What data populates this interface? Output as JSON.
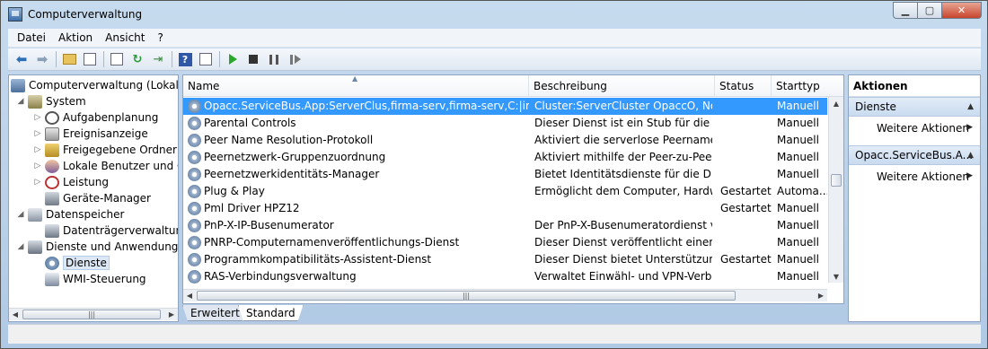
{
  "window": {
    "title": "Computerverwaltung"
  },
  "menu": [
    "Datei",
    "Aktion",
    "Ansicht",
    "?"
  ],
  "toolbar": {
    "icons": [
      "back-icon",
      "forward-icon",
      "up-folder-icon",
      "show-hide-tree-icon",
      "properties-icon",
      "refresh-icon",
      "export-icon",
      "help-icon",
      "console-view-icon",
      "start-service-icon",
      "stop-service-icon",
      "pause-service-icon",
      "restart-service-icon"
    ]
  },
  "tree": {
    "root": "Computerverwaltung (Lokal)",
    "system": "System",
    "aufgabenplanung": "Aufgabenplanung",
    "ereignisanzeige": "Ereignisanzeige",
    "freigegebene_ordner": "Freigegebene Ordner",
    "lokale_benutzer": "Lokale Benutzer und Gru",
    "leistung": "Leistung",
    "geraete_manager": "Geräte-Manager",
    "datenspeicher": "Datenspeicher",
    "datentraegerverwaltung": "Datenträgerverwaltung",
    "dienste_anwendungen": "Dienste und Anwendungen",
    "dienste": "Dienste",
    "wmi": "WMI-Steuerung"
  },
  "services": {
    "columns": {
      "name": "Name",
      "beschreibung": "Beschreibung",
      "status": "Status",
      "starttyp": "Starttyp"
    },
    "rows": [
      {
        "name": "Opacc.ServiceBus.App:ServerClus,firma-serv,firma-serv,C:|insyde",
        "desc": "Cluster:ServerCluster OpaccO, Nod...",
        "status": "",
        "start": "Manuell"
      },
      {
        "name": "Parental Controls",
        "desc": "Dieser Dienst ist ein Stub für die Wi...",
        "status": "",
        "start": "Manuell"
      },
      {
        "name": "Peer Name Resolution-Protokoll",
        "desc": "Aktiviert die serverlose Peernamens...",
        "status": "",
        "start": "Manuell"
      },
      {
        "name": "Peernetzwerk-Gruppenzuordnung",
        "desc": "Aktiviert mithilfe der Peer-zu-Peer-...",
        "status": "",
        "start": "Manuell"
      },
      {
        "name": "Peernetzwerkidentitäts-Manager",
        "desc": "Bietet Identitätsdienste für die Dien...",
        "status": "",
        "start": "Manuell"
      },
      {
        "name": "Plug & Play",
        "desc": "Ermöglicht dem Computer, Hardw...",
        "status": "Gestartet",
        "start": "Automa..."
      },
      {
        "name": "Pml Driver HPZ12",
        "desc": "",
        "status": "Gestartet",
        "start": "Manuell"
      },
      {
        "name": "PnP-X-IP-Busenumerator",
        "desc": "Der PnP-X-Busenumeratordienst v...",
        "status": "",
        "start": "Manuell"
      },
      {
        "name": "PNRP-Computernamenveröffentlichungs-Dienst",
        "desc": "Dieser Dienst veröffentlicht einen C...",
        "status": "",
        "start": "Manuell"
      },
      {
        "name": "Programmkompatibilitäts-Assistent-Dienst",
        "desc": "Dieser Dienst bietet Unterstützung f...",
        "status": "Gestartet",
        "start": "Manuell"
      },
      {
        "name": "RAS-Verbindungsverwaltung",
        "desc": "Verwaltet Einwähl- und VPN-Verbi...",
        "status": "",
        "start": "Manuell"
      }
    ]
  },
  "tabs": [
    "Erweitert",
    "Standard"
  ],
  "actions": {
    "title": "Aktionen",
    "section1": "Dienste",
    "more1": "Weitere Aktionen",
    "section2": "Opacc.ServiceBus.A...",
    "more2": "Weitere Aktionen"
  },
  "colors": {
    "selection": "#3399ff",
    "window_frame": "#b9d1ea"
  }
}
